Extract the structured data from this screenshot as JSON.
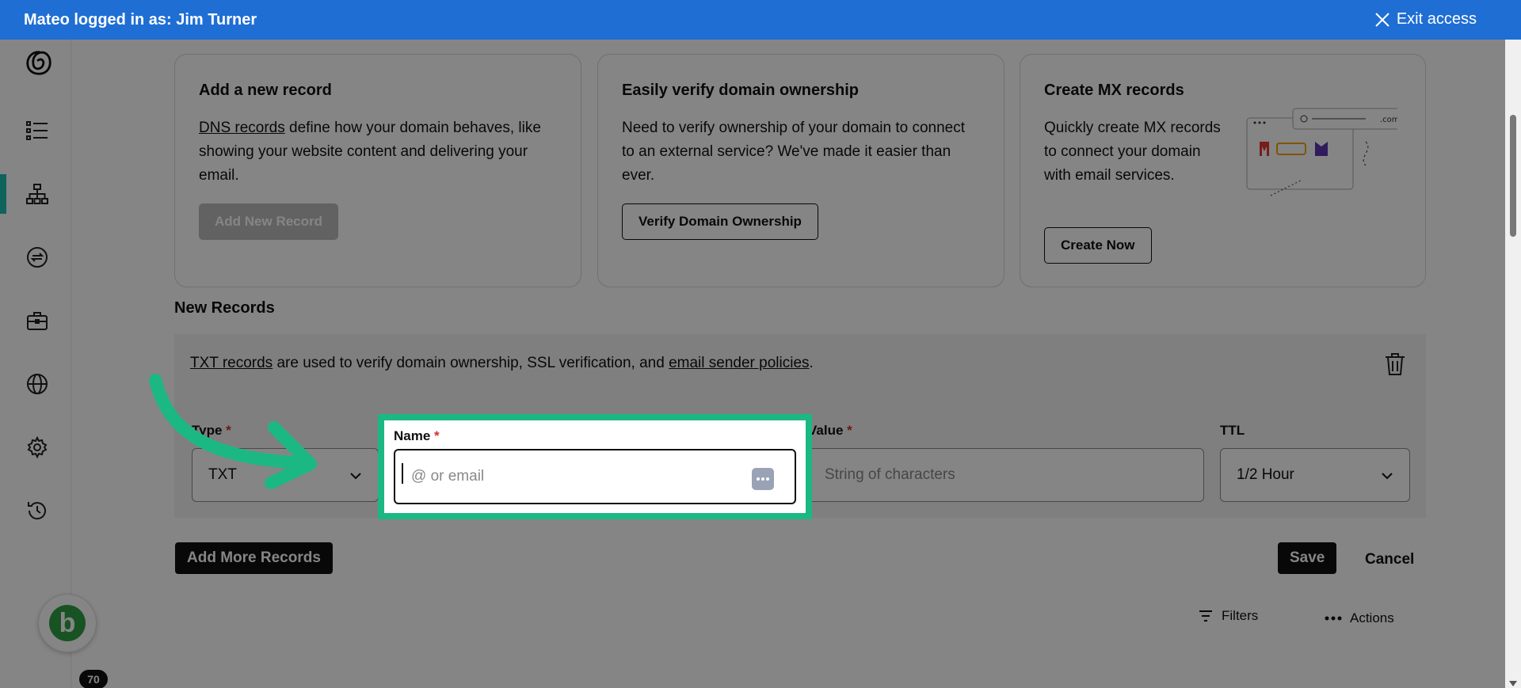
{
  "banner": {
    "login_text": "Mateo logged in as: Jim Turner",
    "exit_label": "Exit access"
  },
  "sidebar": {
    "badge_count": "70",
    "avatar_letter": "b",
    "accent_color": "#1bbfb0"
  },
  "cards": [
    {
      "title": "Add a new record",
      "link": "DNS records",
      "text": " define how your domain behaves, like showing your website content and delivering your email.",
      "button": "Add New Record"
    },
    {
      "title": "Easily verify domain ownership",
      "text": "Need to verify ownership of your domain to connect to an external service? We've made it easier than ever.",
      "button": "Verify Domain Ownership"
    },
    {
      "title": "Create MX records",
      "text": "Quickly create MX records to connect your domain with email services.",
      "button": "Create Now",
      "illus_domain": ".com"
    }
  ],
  "new_records": {
    "title": "New Records",
    "info_link1": "TXT records",
    "info_mid": " are used to verify domain ownership, SSL verification, and ",
    "info_link2": "email sender policies",
    "info_end": ".",
    "fields": {
      "type": {
        "label": "Type",
        "value": "TXT"
      },
      "name": {
        "label": "Name",
        "placeholder": "@ or email"
      },
      "value": {
        "label": "Value",
        "placeholder": "String of characters"
      },
      "ttl": {
        "label": "TTL",
        "value": "1/2 Hour"
      }
    },
    "required_mark": "*"
  },
  "actions": {
    "add_more": "Add More Records",
    "save": "Save",
    "cancel": "Cancel",
    "filters": "Filters",
    "actions": "Actions"
  },
  "colors": {
    "banner": "#1f6ed4",
    "highlight": "#1bb884",
    "required": "#d0312d"
  }
}
